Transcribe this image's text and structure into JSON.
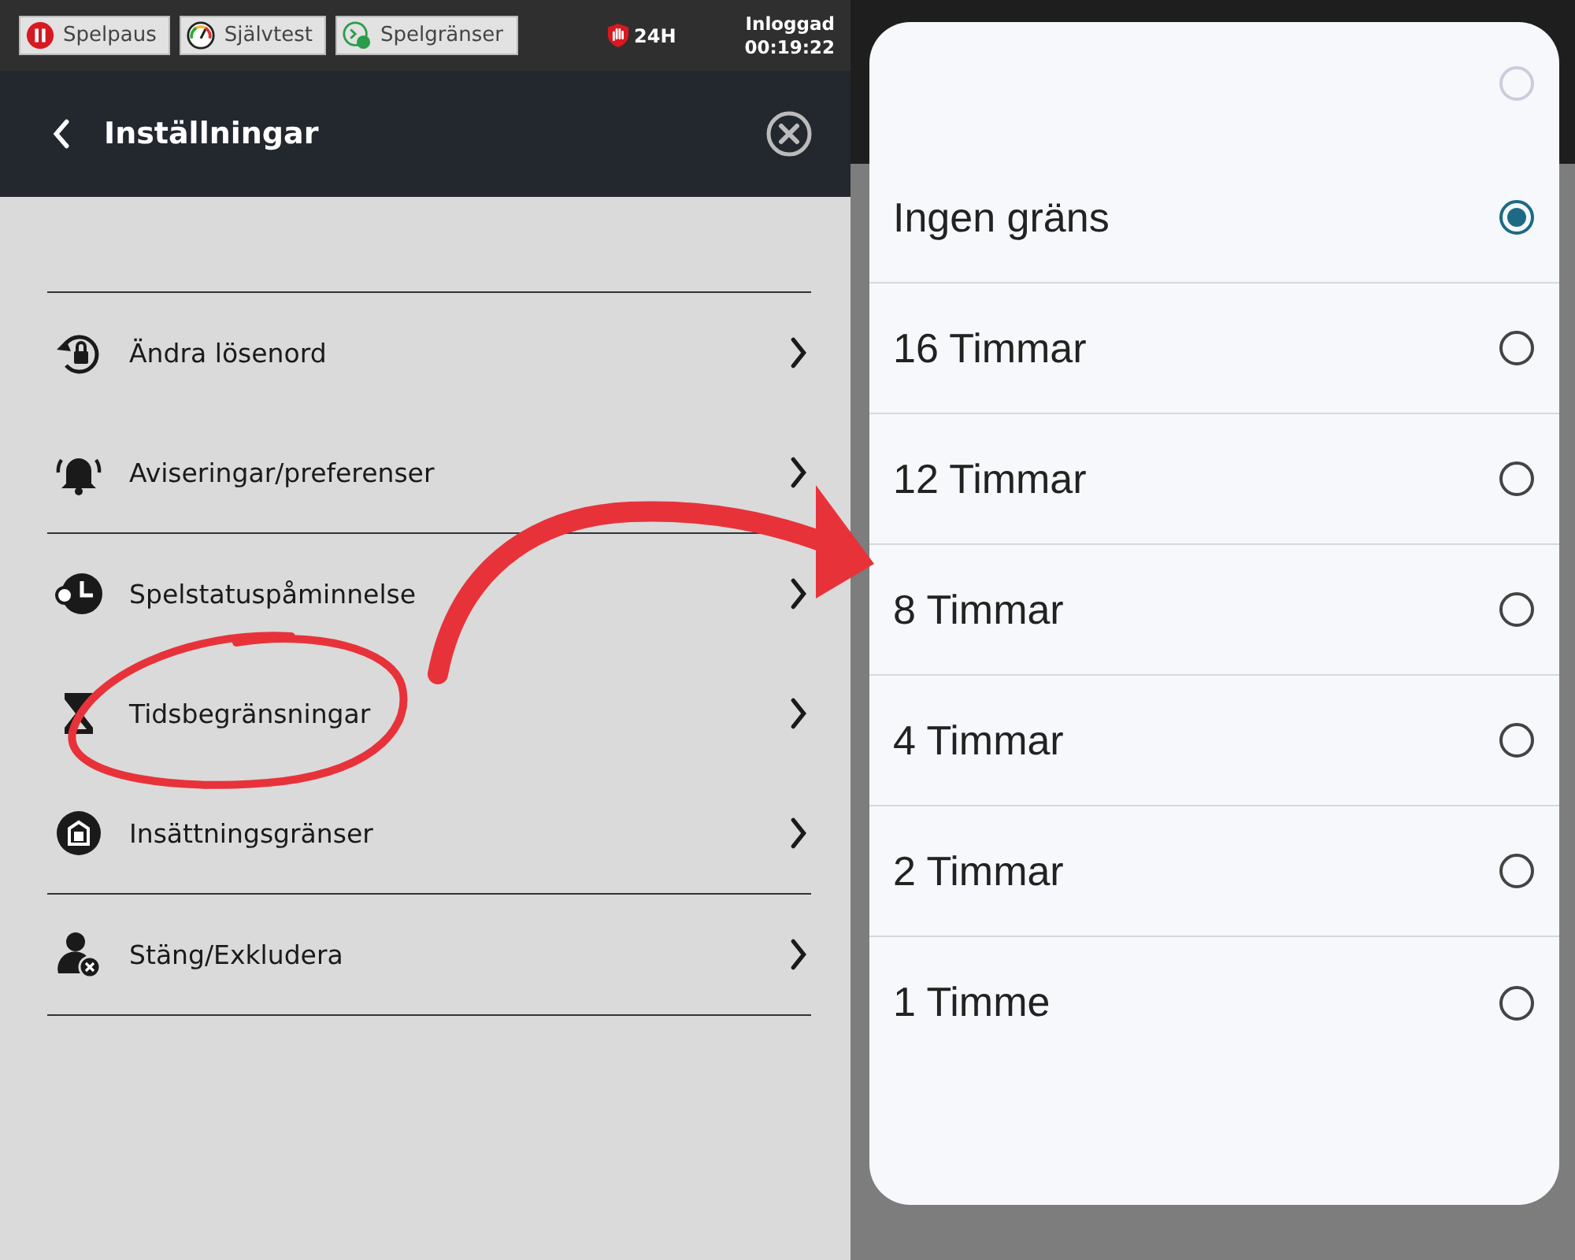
{
  "top_bar": {
    "buttons": [
      {
        "label": "Spelpaus"
      },
      {
        "label": "Självtest"
      },
      {
        "label": "Spelgränser"
      }
    ],
    "limit_badge": "24H",
    "login_label": "Inloggad",
    "login_time": "00:19:22"
  },
  "header": {
    "title": "Inställningar"
  },
  "menu_groups": [
    [
      {
        "label": "Ändra lösenord"
      },
      {
        "label": "Aviseringar/preferenser"
      }
    ],
    [
      {
        "label": "Spelstatuspåminnelse"
      },
      {
        "label": "Tidsbegränsningar",
        "circled": true
      },
      {
        "label": "Insättningsgränser"
      }
    ],
    [
      {
        "label": "Stäng/Exkludera"
      }
    ]
  ],
  "options": [
    {
      "selected": false
    },
    {
      "label": "Ingen gräns",
      "selected": true
    },
    {
      "label": "16 Timmar",
      "selected": false
    },
    {
      "label": "12 Timmar",
      "selected": false
    },
    {
      "label": "8 Timmar",
      "selected": false
    },
    {
      "label": "4 Timmar",
      "selected": false
    },
    {
      "label": "2 Timmar",
      "selected": false
    },
    {
      "label": "1 Timme",
      "selected": false
    }
  ]
}
